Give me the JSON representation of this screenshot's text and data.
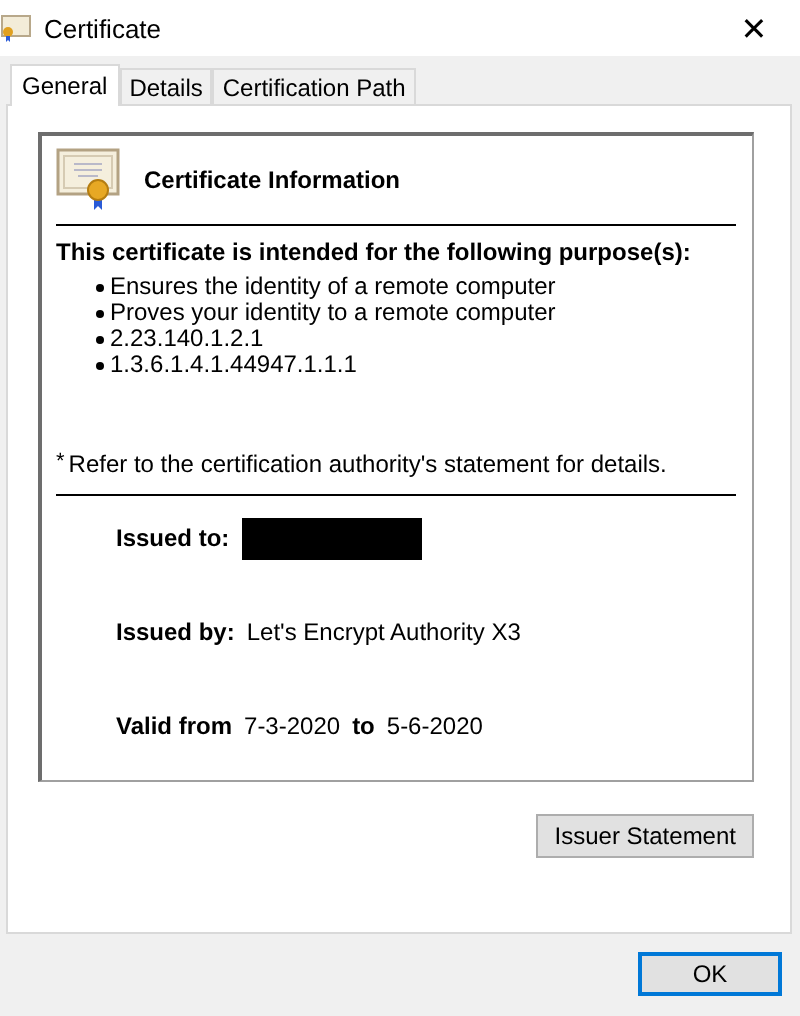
{
  "window": {
    "title": "Certificate",
    "close": "✕"
  },
  "tabs": [
    {
      "label": "General",
      "selected": true
    },
    {
      "label": "Details",
      "selected": false
    },
    {
      "label": "Certification Path",
      "selected": false
    }
  ],
  "info": {
    "heading": "Certificate Information",
    "purpose_title": "This certificate is intended for the following purpose(s):",
    "purposes": [
      "Ensures the identity of a remote computer",
      "Proves your identity to a remote computer",
      "2.23.140.1.2.1",
      "1.3.6.1.4.1.44947.1.1.1"
    ],
    "note_mark": "*",
    "note": "Refer to the certification authority's statement for details."
  },
  "fields": [
    {
      "label": "Issued to:",
      "redacted": true
    },
    {
      "label": "Issued by:",
      "value": "Let's Encrypt Authority X3",
      "redacted": false
    }
  ],
  "validity": {
    "label": "Valid from",
    "from": "7-3-2020",
    "to_label": "to",
    "to": "5-6-2020"
  },
  "buttons": {
    "statement": "Issuer Statement",
    "ok": "OK"
  }
}
